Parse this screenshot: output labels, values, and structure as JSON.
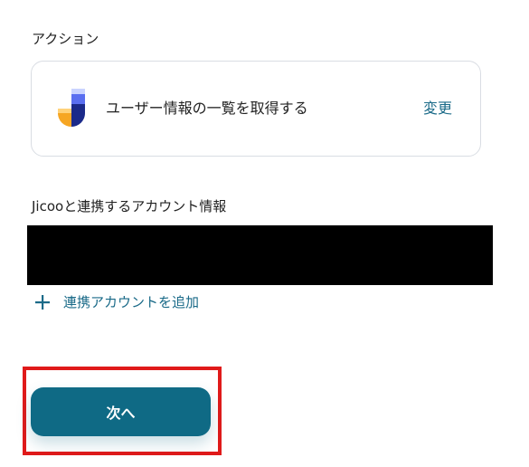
{
  "action_section": {
    "label": "アクション",
    "action_text": "ユーザー情報の一覧を取得する",
    "change_label": "変更",
    "app_icon": "jicoo-logo-icon"
  },
  "account_section": {
    "label": "Jicooと連携するアカウント情報",
    "add_account_label": "連携アカウントを追加",
    "add_icon": "plus-icon"
  },
  "next_button": {
    "label": "次へ"
  },
  "colors": {
    "accent": "#1a6a88",
    "button": "#0f6a85",
    "highlight": "#e01a1a",
    "card_border": "#d9dde3"
  }
}
